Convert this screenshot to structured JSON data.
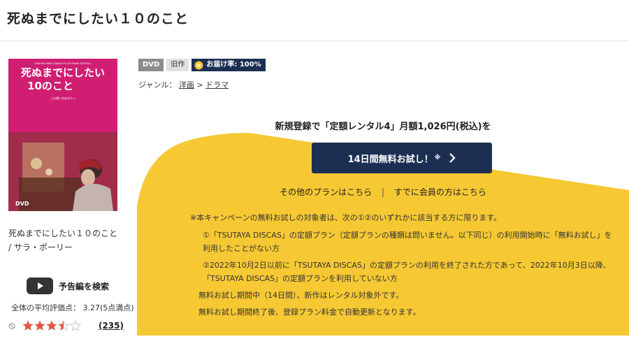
{
  "page": {
    "title": "死ぬまでにしたい１０のこと"
  },
  "cover": {
    "top_credit": "TAKASHI MIIKE  SARAH POLLEY  MARK RUFFALO",
    "title_line1": "死ぬまでにしたい",
    "title_line2": "10のこと",
    "tagline": "この想いをあなたへ",
    "dvd_logo": "DVD"
  },
  "work": {
    "title": "死ぬまでにしたい１０のこと / サラ・ポーリー",
    "trailer_label": "予告編を検索",
    "avg_rating": "全体の平均評価点： 3.27(5点満点)",
    "stars_filled": 3.5,
    "stars_total": 5,
    "review_count": "(235)"
  },
  "badges": {
    "dvd": "DVD",
    "old": "旧作",
    "delivery": "お届け率: 100%"
  },
  "genre": {
    "label": "ジャンル：",
    "main": "洋画",
    "separator": ">",
    "sub": "ドラマ"
  },
  "offer": {
    "text": "新規登録で「定額レンタル4」月額1,026円(税込)を",
    "button": "14日間無料お試し！",
    "button_mark": "※",
    "other_plans": "その他のプランはこちら",
    "separator": "|",
    "member": "すでに会員の方はこちら"
  },
  "notes": {
    "head": "※本キャンペーンの無料お試しの対象者は、次の①②のいずれかに該当する方に限ります。",
    "item1": "①「TSUTAYA DISCAS」の定額プラン（定額プランの種類は問いません。以下同じ）の利用開始時に「無料お試し」を利用したことがない方",
    "item2": "②2022年10月2日以前に「TSUTAYA DISCAS」の定額プランの利用を終了された方であって、2022年10月3日以降、「TSUTAYA DISCAS」の定額プランを利用していない方",
    "line3": "無料お試し期間中（14日間）、新作はレンタル対象外です。",
    "line4": "無料お試し期間終了後、登録プラン料金で自動更新となります。"
  },
  "colors": {
    "accent_navy": "#1c2f53",
    "panel_yellow": "#f6c833",
    "star": "#e8553e",
    "cover_pink": "#d9227a"
  }
}
